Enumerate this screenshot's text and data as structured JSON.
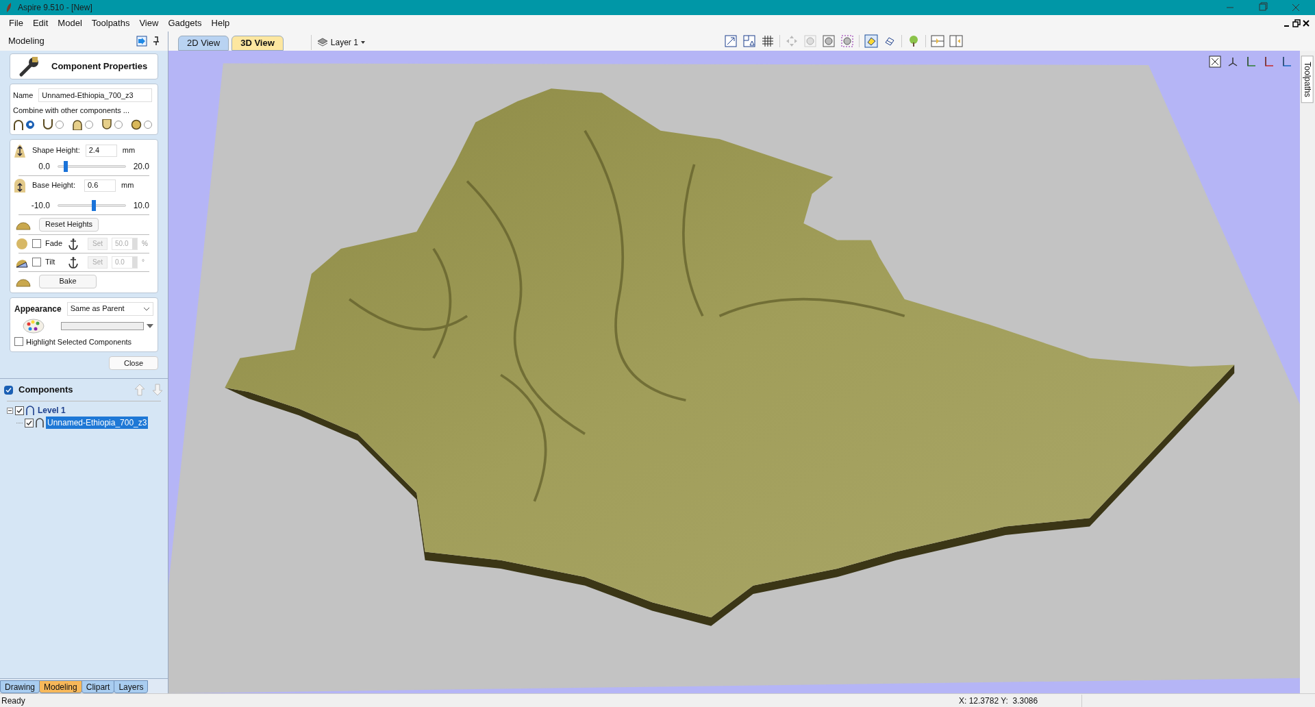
{
  "window": {
    "title": "Aspire 9.510 - [New]"
  },
  "menu": [
    "File",
    "Edit",
    "Model",
    "Toolpaths",
    "View",
    "Gadgets",
    "Help"
  ],
  "panel": {
    "title": "Modeling"
  },
  "view_tabs": [
    {
      "label": "2D View",
      "selected": false
    },
    {
      "label": "3D View",
      "selected": true
    }
  ],
  "layer_menu": {
    "label": "Layer 1"
  },
  "properties": {
    "title": "Component Properties",
    "name_label": "Name",
    "name_value": "Unnamed-Ethiopia_700_z3",
    "combine_label": "Combine with other components ...",
    "combine_modes": [
      {
        "kind": "add",
        "selected": true
      },
      {
        "kind": "subtract",
        "selected": false
      },
      {
        "kind": "merge",
        "selected": false
      },
      {
        "kind": "low",
        "selected": false
      },
      {
        "kind": "multiply",
        "selected": false
      }
    ],
    "shape_height": {
      "label": "Shape Height:",
      "value": "2.4",
      "unit": "mm",
      "min": "0.0",
      "max": "20.0",
      "level": 0.12
    },
    "base_height": {
      "label": "Base Height:",
      "value": "0.6",
      "unit": "mm",
      "min": "-10.0",
      "max": "10.0",
      "level": 0.53
    },
    "reset_button": "Reset Heights",
    "fade": {
      "label": "Fade",
      "checked": false,
      "set_button": "Set",
      "value": "50.0",
      "unit": "%"
    },
    "tilt": {
      "label": "Tilt",
      "checked": false,
      "set_button": "Set",
      "value": "0.0",
      "unit": "°"
    },
    "bake_button": "Bake",
    "appearance_label": "Appearance",
    "appearance_value": "Same as Parent",
    "highlight": {
      "label": "Highlight Selected Components",
      "checked": false
    },
    "close_button": "Close"
  },
  "components": {
    "title": "Components",
    "checked": true,
    "tree": [
      {
        "label": "Level 1",
        "checked": true,
        "selected": false,
        "expanded": true,
        "children": [
          {
            "label": "Unnamed-Ethiopia_700_z3",
            "checked": true,
            "selected": true
          }
        ]
      }
    ]
  },
  "bottom_tabs": [
    {
      "label": "Drawing",
      "selected": false
    },
    {
      "label": "Modeling",
      "selected": true
    },
    {
      "label": "Clipart",
      "selected": false
    },
    {
      "label": "Layers",
      "selected": false
    }
  ],
  "right_tab": {
    "label": "Toolpaths"
  },
  "status_bar": {
    "message": "Ready",
    "coordinates": "X: 12.3782 Y:  3.3086"
  }
}
